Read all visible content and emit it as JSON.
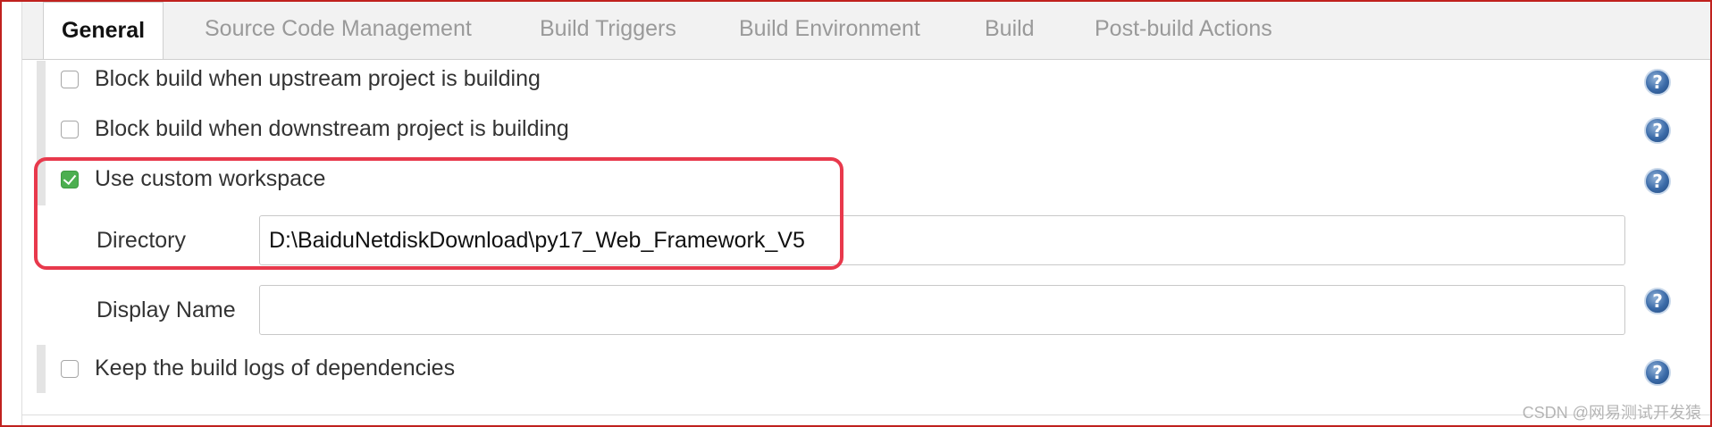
{
  "tabs": [
    {
      "label": "General",
      "active": true
    },
    {
      "label": "Source Code Management",
      "active": false
    },
    {
      "label": "Build Triggers",
      "active": false
    },
    {
      "label": "Build Environment",
      "active": false
    },
    {
      "label": "Build",
      "active": false
    },
    {
      "label": "Post-build Actions",
      "active": false
    }
  ],
  "options": {
    "block_upstream": {
      "label": "Block build when upstream project is building",
      "checked": false
    },
    "block_downstream": {
      "label": "Block build when downstream project is building",
      "checked": false
    },
    "custom_workspace": {
      "label": "Use custom workspace",
      "checked": true
    },
    "keep_logs": {
      "label": "Keep the build logs of dependencies",
      "checked": false
    }
  },
  "fields": {
    "directory": {
      "label": "Directory",
      "value": "D:\\BaiduNetdiskDownload\\py17_Web_Framework_V5"
    },
    "display_name": {
      "label": "Display Name",
      "value": ""
    }
  },
  "help_icon_glyph": "?",
  "watermark": "CSDN @网易测试开发猿",
  "colors": {
    "highlight": "#e8394c",
    "checkbox_checked": "#4caf50",
    "help_icon": "#3a6aa8",
    "frame_border": "#c0211e"
  }
}
